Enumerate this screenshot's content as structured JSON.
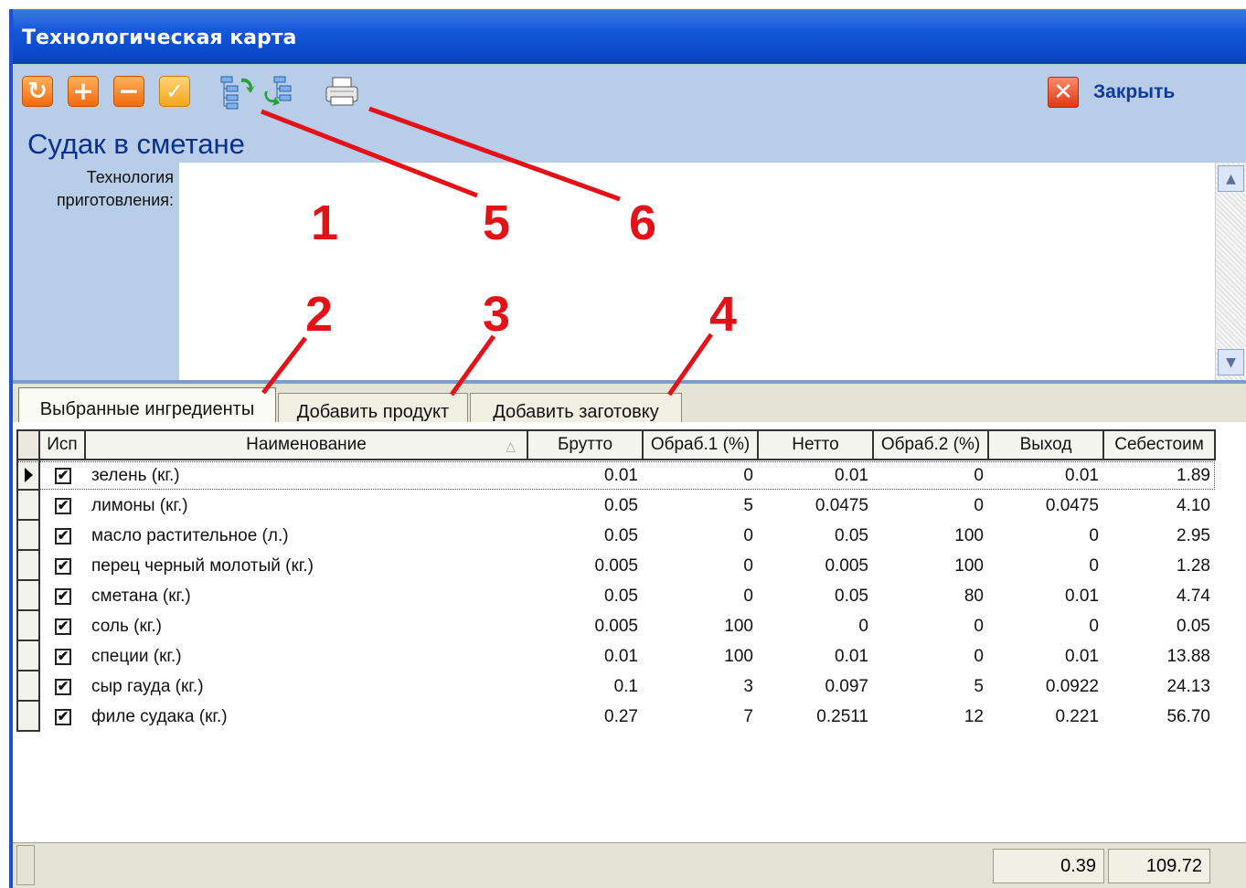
{
  "window": {
    "title": "Технологическая карта"
  },
  "toolbar": {
    "close_label": "Закрыть",
    "icons": [
      "refresh-icon",
      "add-icon",
      "remove-icon",
      "check-icon",
      "tree-refresh-icon",
      "tree-move-icon",
      "print-icon",
      "close-icon"
    ]
  },
  "dish": {
    "title": "Судак в сметане"
  },
  "tech": {
    "label_line1": "Технология",
    "label_line2": "приготовления:",
    "text": ""
  },
  "tabs": [
    {
      "label": "Выбранные ингредиенты"
    },
    {
      "label": "Добавить продукт"
    },
    {
      "label": "Добавить заготовку"
    }
  ],
  "grid": {
    "columns": [
      "Исп",
      "Наименование",
      "Брутто",
      "Обраб.1 (%)",
      "Нетто",
      "Обраб.2 (%)",
      "Выход",
      "Себестоим"
    ],
    "rows": [
      {
        "name": "зелень (кг.)",
        "brutto": "0.01",
        "obr1": "0",
        "netto": "0.01",
        "obr2": "0",
        "vyhod": "0.01",
        "cost": "1.89"
      },
      {
        "name": "лимоны (кг.)",
        "brutto": "0.05",
        "obr1": "5",
        "netto": "0.0475",
        "obr2": "0",
        "vyhod": "0.0475",
        "cost": "4.10"
      },
      {
        "name": "масло растительное (л.)",
        "brutto": "0.05",
        "obr1": "0",
        "netto": "0.05",
        "obr2": "100",
        "vyhod": "0",
        "cost": "2.95"
      },
      {
        "name": "перец черный молотый (кг.)",
        "brutto": "0.005",
        "obr1": "0",
        "netto": "0.005",
        "obr2": "100",
        "vyhod": "0",
        "cost": "1.28"
      },
      {
        "name": "сметана (кг.)",
        "brutto": "0.05",
        "obr1": "0",
        "netto": "0.05",
        "obr2": "80",
        "vyhod": "0.01",
        "cost": "4.74"
      },
      {
        "name": "соль (кг.)",
        "brutto": "0.005",
        "obr1": "100",
        "netto": "0",
        "obr2": "0",
        "vyhod": "0",
        "cost": "0.05"
      },
      {
        "name": "специи (кг.)",
        "brutto": "0.01",
        "obr1": "100",
        "netto": "0.01",
        "obr2": "0",
        "vyhod": "0.01",
        "cost": "13.88"
      },
      {
        "name": "сыр гауда (кг.)",
        "brutto": "0.1",
        "obr1": "3",
        "netto": "0.097",
        "obr2": "5",
        "vyhod": "0.0922",
        "cost": "24.13"
      },
      {
        "name": "филе судака (кг.)",
        "brutto": "0.27",
        "obr1": "7",
        "netto": "0.2511",
        "obr2": "12",
        "vyhod": "0.221",
        "cost": "56.70"
      }
    ]
  },
  "totals": {
    "vyhod": "0.39",
    "cost": "109.72"
  },
  "annotations": [
    "1",
    "2",
    "3",
    "4",
    "5",
    "6"
  ],
  "colors": {
    "title_bar": "#1557d8",
    "window_bg": "#b8cde8",
    "annotation": "#e41218",
    "accent_orange": "#f06a10"
  }
}
